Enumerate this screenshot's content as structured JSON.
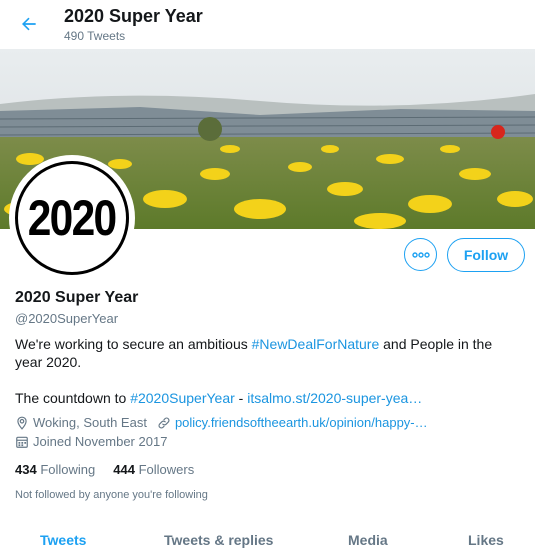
{
  "header": {
    "title": "2020 Super Year",
    "tweet_count": "490 Tweets",
    "back_icon": "arrow-left-icon"
  },
  "profile": {
    "avatar_text": "2020",
    "name": "2020 Super Year",
    "handle": "@2020SuperYear",
    "follow_label": "Follow",
    "more_icon": "more-dots-icon",
    "bio": {
      "line1_before": "We're working to secure an ambitious ",
      "line1_hashtag": "#NewDealForNature",
      "line1_after": " and People in the year 2020.",
      "line2_before": "The countdown to ",
      "line2_hashtag": "#2020SuperYear",
      "line2_sep": " - ",
      "line2_link": "itsalmo.st/2020-super-yea…"
    },
    "location": "Woking, South East",
    "website": "policy.friendsoftheearth.uk/opinion/happy-…",
    "joined": "Joined November 2017",
    "following_count": "434",
    "following_label": "Following",
    "followers_count": "444",
    "followers_label": "Followers",
    "not_followed": "Not followed by anyone you're following"
  },
  "tabs": [
    {
      "label": "Tweets",
      "active": true
    },
    {
      "label": "Tweets & replies",
      "active": false
    },
    {
      "label": "Media",
      "active": false
    },
    {
      "label": "Likes",
      "active": false
    }
  ],
  "colors": {
    "accent": "#1da1f2",
    "link": "#1b95e0",
    "muted": "#657786"
  }
}
